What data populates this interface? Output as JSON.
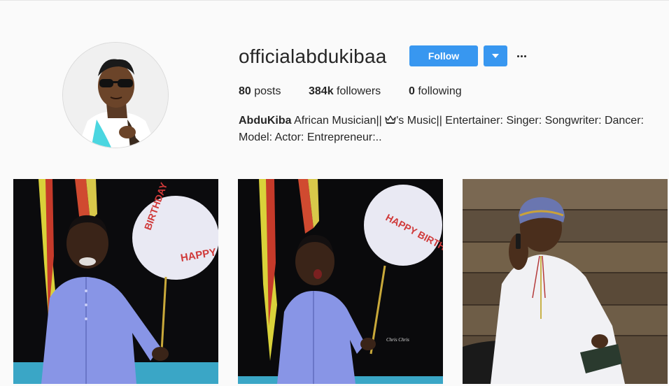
{
  "profile": {
    "username": "officialabdukibaa",
    "follow_label": "Follow",
    "stats": {
      "posts_count": "80",
      "posts_label": "posts",
      "followers_count": "384k",
      "followers_label": "followers",
      "following_count": "0",
      "following_label": "following"
    },
    "bio": {
      "name": "AbduKiba",
      "text_before_icon": "African Musician||",
      "text_after_icon": "'s Music|| Entertainer: Singer: Songwriter: Dancer: Model: Actor: Entrepreneur:.."
    }
  },
  "icons": {
    "dropdown": "chevron-down-icon",
    "more": "more-options-icon",
    "crown": "crown-emoji-icon"
  },
  "posts": [
    {
      "balloon_text": "HAPPY BIRTHDAY"
    },
    {
      "balloon_text": "HAPPY BIRTHDAY",
      "watermark": "Chris Chris"
    },
    {}
  ],
  "colors": {
    "accent": "#3897f0",
    "background": "#fafafa",
    "text": "#262626"
  }
}
